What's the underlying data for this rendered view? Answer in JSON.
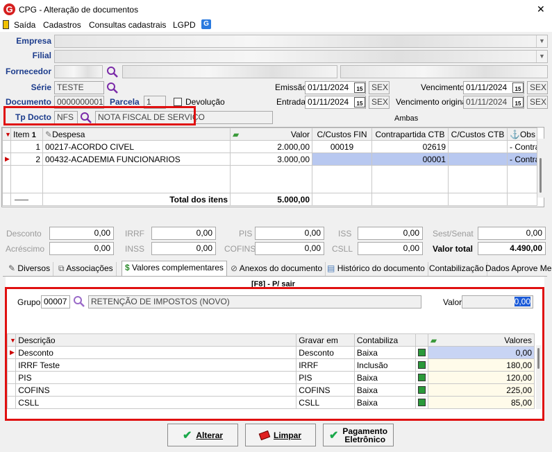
{
  "window": {
    "title": "CPG - Alteração de documentos",
    "close": "✕"
  },
  "menu": {
    "saida": "Saída",
    "cadastros": "Cadastros",
    "consultas": "Consultas cadastrais",
    "lgpd": "LGPD"
  },
  "form": {
    "empresa_label": "Empresa",
    "filial_label": "Filial",
    "fornecedor_label": "Fornecedor",
    "serie_label": "Série",
    "serie_value": "TESTE",
    "documento_label": "Documento",
    "documento_value": "0000000001",
    "parcela_label": "Parcela",
    "parcela_value": "1",
    "devolucao_label": "Devolução",
    "tpdocto_label": "Tp Docto",
    "tpdocto_code": "NFS",
    "tpdocto_desc": "NOTA FISCAL DE SERVIÇO",
    "emissao_label": "Emissão",
    "emissao_value": "01/11/2024",
    "emissao_dow": "SEX",
    "entrada_label": "Entrada",
    "entrada_value": "01/11/2024",
    "entrada_dow": "SEX",
    "vencimento_label": "Vencimento",
    "vencimento_value": "01/11/2024",
    "vencimento_dow": "SEX",
    "venc_original_label": "Vencimento original",
    "venc_original_value": "01/11/2024",
    "venc_original_dow": "SEX",
    "ambas": "Ambas",
    "cal_glyph": "15"
  },
  "items_table": {
    "headers": {
      "item": "Item",
      "sort": "1",
      "despesa": "Despesa",
      "valor": "Valor",
      "cc_fin": "C/Custos FIN",
      "contrapartida": "Contrapartida CTB",
      "cc_ctb": "C/Custos CTB",
      "obs": "Obs"
    },
    "rows": [
      {
        "item": "1",
        "despesa": "00217-ACORDO CIVEL",
        "valor": "2.000,00",
        "cc_fin": "00019",
        "contrapartida": "02619",
        "cc_ctb": "",
        "obs": "- Contra"
      },
      {
        "item": "2",
        "despesa": "00432-ACADEMIA FUNCIONARIOS",
        "valor": "3.000,00",
        "cc_fin": "",
        "contrapartida": "00001",
        "cc_ctb": "",
        "obs": "- Contra"
      }
    ],
    "total_label": "Total dos itens",
    "total_value": "5.000,00"
  },
  "taxes": {
    "desconto": {
      "label": "Desconto",
      "value": "0,00"
    },
    "acrescimo": {
      "label": "Acréscimo",
      "value": "0,00"
    },
    "irrf": {
      "label": "IRRF",
      "value": "0,00"
    },
    "inss": {
      "label": "INSS",
      "value": "0,00"
    },
    "pis": {
      "label": "PIS",
      "value": "0,00"
    },
    "cofins": {
      "label": "COFINS",
      "value": "0,00"
    },
    "iss": {
      "label": "ISS",
      "value": "0,00"
    },
    "csll": {
      "label": "CSLL",
      "value": "0,00"
    },
    "sest": {
      "label": "Sest/Senat",
      "value": "0,00"
    },
    "valor_total": {
      "label": "Valor total",
      "value": "4.490,00"
    }
  },
  "tabs": [
    "Diversos",
    "Associações",
    "Valores complementares",
    "Anexos do documento",
    "Histórico do documento",
    "Contabilização",
    "Dados Aprove Me"
  ],
  "panel": {
    "hint": "[F8] - P/ sair",
    "grupo_label": "Grupo",
    "grupo_code": "00007",
    "grupo_desc": "RETENÇÃO DE IMPOSTOS (NOVO)",
    "valor_label": "Valor",
    "valor_value": "0,00"
  },
  "comp_table": {
    "headers": {
      "descricao": "Descrição",
      "gravar": "Gravar em",
      "contabiliza": "Contabiliza",
      "valores": "Valores"
    },
    "rows": [
      {
        "descricao": "Desconto",
        "gravar": "Desconto",
        "contabiliza": "Baixa",
        "valor": "0,00"
      },
      {
        "descricao": "IRRF Teste",
        "gravar": "IRRF",
        "contabiliza": "Inclusão",
        "valor": "180,00"
      },
      {
        "descricao": "PIS",
        "gravar": "PIS",
        "contabiliza": "Baixa",
        "valor": "120,00"
      },
      {
        "descricao": "COFINS",
        "gravar": "COFINS",
        "contabiliza": "Baixa",
        "valor": "225,00"
      },
      {
        "descricao": "CSLL",
        "gravar": "CSLL",
        "contabiliza": "Baixa",
        "valor": "85,00"
      }
    ]
  },
  "buttons": {
    "alterar": "Alterar",
    "limpar": "Limpar",
    "pagamento_1": "Pagamento",
    "pagamento_2": "Eletrônico"
  },
  "colors": {
    "accent_red": "#e01010",
    "label_blue": "#1c3c8c",
    "selection": "#b8c8f0",
    "logo_red": "#d62020"
  }
}
